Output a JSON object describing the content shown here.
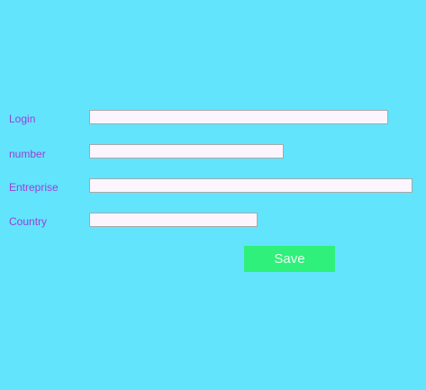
{
  "form": {
    "fields": [
      {
        "label": "Login",
        "value": "",
        "placeholder": ""
      },
      {
        "label": "number",
        "value": "",
        "placeholder": ""
      },
      {
        "label": "Entreprise",
        "value": "",
        "placeholder": ""
      },
      {
        "label": "Country",
        "value": "",
        "placeholder": ""
      }
    ],
    "save_label": "Save"
  },
  "colors": {
    "background": "#62e4fd",
    "label_text": "#9b3fd6",
    "input_background": "#fdf5fd",
    "save_button": "#2ef07a"
  }
}
